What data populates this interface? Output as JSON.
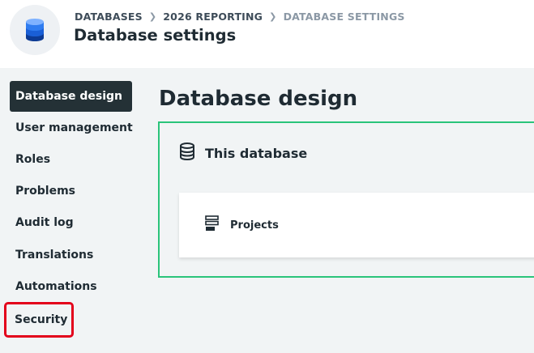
{
  "header": {
    "breadcrumb": [
      "DATABASES",
      "2026 REPORTING",
      "DATABASE SETTINGS"
    ],
    "title": "Database settings",
    "logo_icon": "database-stack-icon",
    "separator_icon": "chevron-right-icon"
  },
  "sidebar": {
    "items": [
      {
        "label": "Database design",
        "state": "active"
      },
      {
        "label": "User management"
      },
      {
        "label": "Roles"
      },
      {
        "label": "Problems"
      },
      {
        "label": "Audit log"
      },
      {
        "label": "Translations"
      },
      {
        "label": "Automations"
      },
      {
        "label": "Security",
        "state": "highlighted"
      }
    ]
  },
  "main": {
    "title": "Database design",
    "section": {
      "label": "This database",
      "icon": "database-icon",
      "tables": [
        {
          "label": "Projects",
          "icon": "table-icon"
        }
      ]
    }
  },
  "colors": {
    "active_bg": "#243136",
    "card_border": "#2ac47a",
    "highlight_border": "#e3001b",
    "logo_blue": "#1a5fd6"
  }
}
